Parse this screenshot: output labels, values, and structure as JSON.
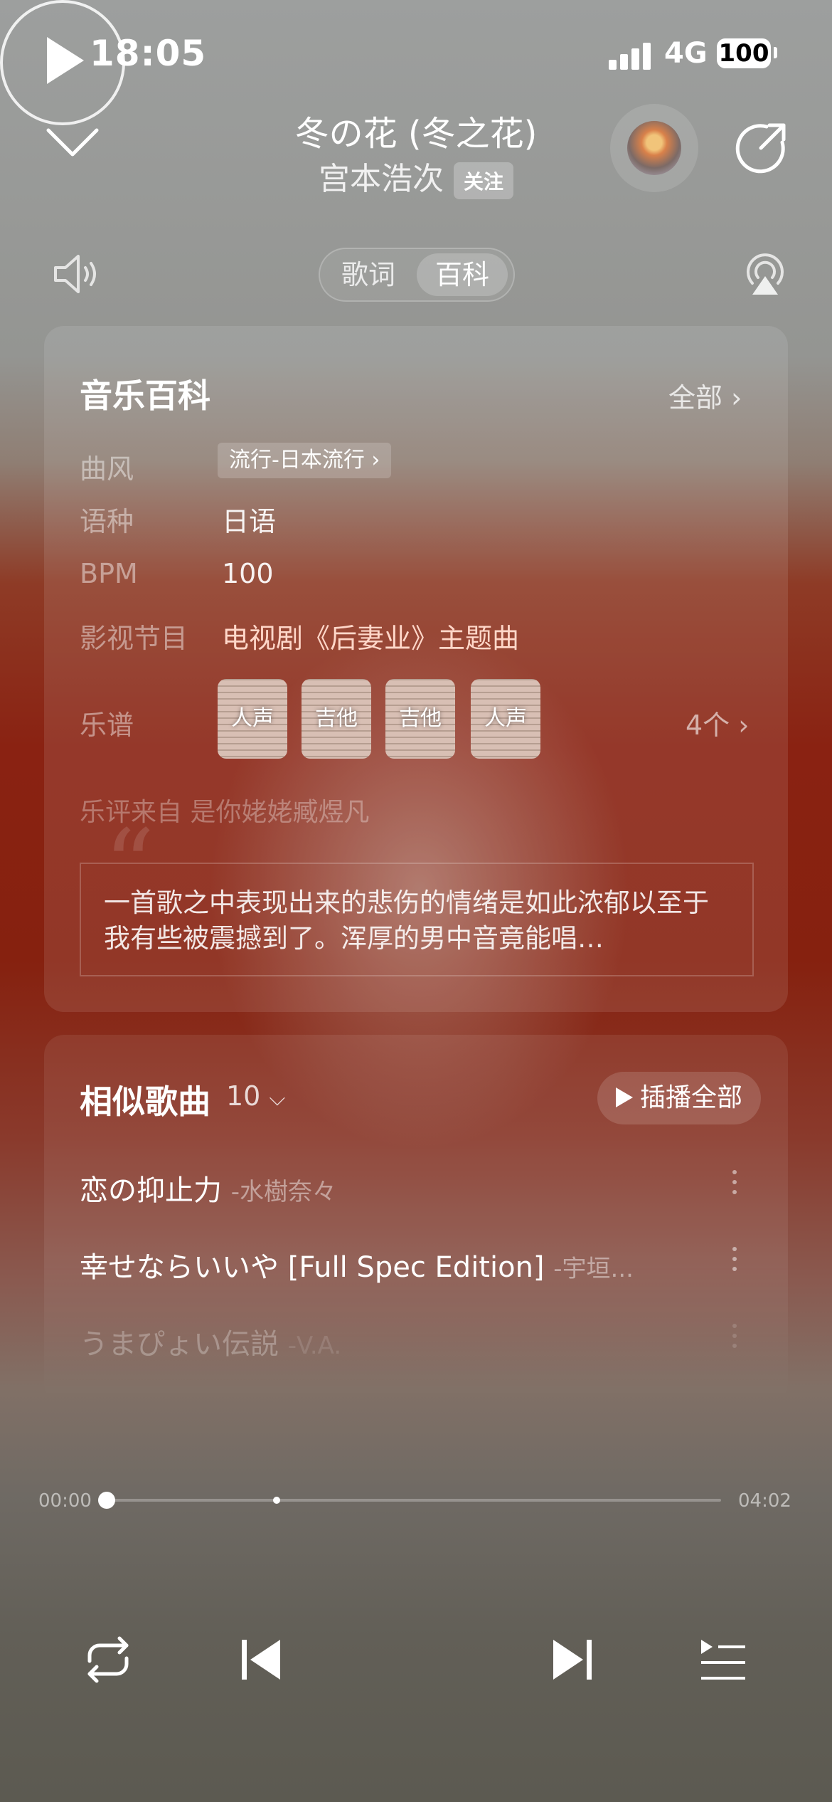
{
  "status_bar": {
    "time": "18:05",
    "network": "4G",
    "battery": "100"
  },
  "header": {
    "title": "冬の花 (冬之花)",
    "artist": "宫本浩次",
    "follow_label": "关注"
  },
  "tabs": [
    {
      "label": "歌词",
      "active": false
    },
    {
      "label": "百科",
      "active": true
    }
  ],
  "wiki": {
    "title": "音乐百科",
    "all_label": "全部",
    "genre_label": "曲风",
    "genre_value": "流行-日本流行",
    "language_label": "语种",
    "language_value": "日语",
    "bpm_label": "BPM",
    "bpm_value": "100",
    "tv_label": "影视节目",
    "tv_value": "电视剧《后妻业》主题曲",
    "score_label": "乐谱",
    "scores": [
      "人声",
      "吉他",
      "吉他",
      "人声"
    ],
    "score_count": "4个",
    "review_source": "乐评来自 是你姥姥臧煜凡",
    "review_text": "一首歌之中表现出来的悲伤的情绪是如此浓郁以至于我有些被震撼到了。浑厚的男中音竟能唱…"
  },
  "similar": {
    "title": "相似歌曲",
    "count": "10",
    "play_all_label": "插播全部",
    "songs": [
      {
        "title": "恋の抑止力",
        "artist": "-水樹奈々"
      },
      {
        "title": "幸せならいいや [Full Spec Edition]",
        "artist": "-宇垣..."
      },
      {
        "title": "うまぴょい伝説",
        "artist": "-V.A."
      }
    ]
  },
  "progress": {
    "current": "00:00",
    "total": "04:02",
    "fraction": 0.0
  },
  "colors": {
    "accent_text": "#ffd7c9",
    "background_red": "#8a2212"
  },
  "icons": [
    "chevron-down-icon",
    "share-icon",
    "speaker-icon",
    "airplay-icon",
    "repeat-icon",
    "previous-icon",
    "play-icon",
    "next-icon",
    "playlist-icon"
  ]
}
